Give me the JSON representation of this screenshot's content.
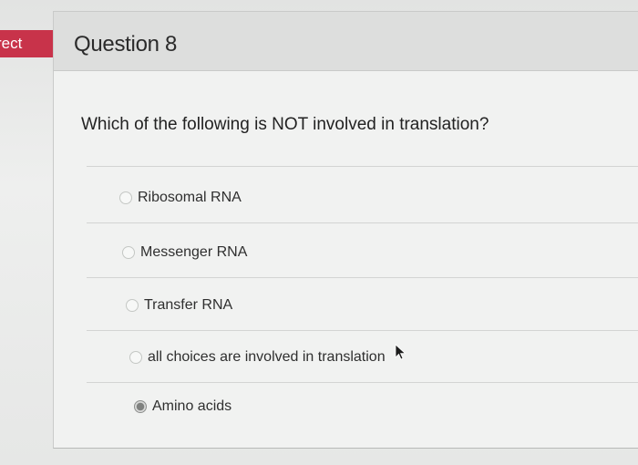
{
  "status": {
    "label": "rect"
  },
  "question": {
    "title": "Question 8",
    "text": "Which of the following is NOT involved in translation?"
  },
  "options": [
    {
      "label": "Ribosomal RNA",
      "selected": false
    },
    {
      "label": "Messenger RNA",
      "selected": false
    },
    {
      "label": "Transfer RNA",
      "selected": false
    },
    {
      "label": "all choices are involved in translation",
      "selected": false
    },
    {
      "label": "Amino acids",
      "selected": true
    }
  ],
  "icons": {
    "pointer": "mouse-pointer-icon"
  },
  "colors": {
    "status_tab": "#c8334a",
    "selected_radio": "#7f817f"
  }
}
